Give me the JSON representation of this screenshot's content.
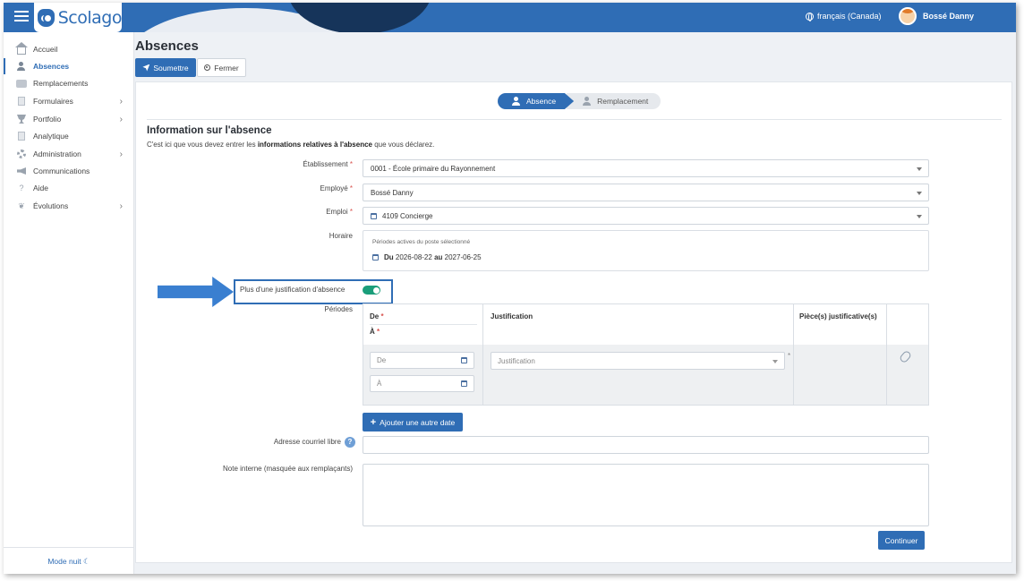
{
  "app": {
    "logo_text": "Scolago"
  },
  "header": {
    "language": "français (Canada)",
    "user_name": "Bossé Danny"
  },
  "sidebar": {
    "items": [
      {
        "label": "Accueil",
        "icon": "home-icon"
      },
      {
        "label": "Absences",
        "icon": "person-icon",
        "active": true
      },
      {
        "label": "Remplacements",
        "icon": "chat-icon"
      },
      {
        "label": "Formulaires",
        "icon": "document-icon",
        "has_submenu": true
      },
      {
        "label": "Portfolio",
        "icon": "trophy-icon",
        "has_submenu": true
      },
      {
        "label": "Analytique",
        "icon": "document-icon"
      },
      {
        "label": "Administration",
        "icon": "gear-icon",
        "has_submenu": true
      },
      {
        "label": "Communications",
        "icon": "megaphone-icon"
      },
      {
        "label": "Aide",
        "icon": "question-icon"
      },
      {
        "label": "Évolutions",
        "icon": "sprout-icon",
        "has_submenu": true
      }
    ],
    "night_mode": "Mode nuit"
  },
  "page": {
    "title": "Absences",
    "submit_label": "Soumettre",
    "close_label": "Fermer"
  },
  "steps": {
    "step1": "Absence",
    "step2": "Remplacement"
  },
  "form": {
    "section_title": "Information sur l'absence",
    "desc_before": "C'est ici que vous devez entrer les ",
    "desc_bold": "informations relatives à l'absence",
    "desc_after": " que vous déclarez.",
    "etablissement_label": "Établissement",
    "etablissement_value": "0001 - École primaire du Rayonnement",
    "employe_label": "Employé",
    "employe_value": "Bossé Danny",
    "emploi_label": "Emploi",
    "emploi_value": "4109 Concierge",
    "horaire_label": "Horaire",
    "horaire_sub": "Périodes actives du poste sélectionné",
    "horaire_du": "Du",
    "horaire_start": "2026-08-22",
    "horaire_au": "au",
    "horaire_end": "2027-06-25",
    "multi_justification_label": "Plus d'une justification d'absence",
    "multi_justification_on": true,
    "periods_label": "Périodes",
    "col_from": "De",
    "col_to": "À",
    "col_justification": "Justification",
    "col_documents": "Pièce(s) justificative(s)",
    "from_placeholder": "De",
    "to_placeholder": "À",
    "justification_placeholder": "Justification",
    "add_date_label": "Ajouter une autre date",
    "email_label": "Adresse courriel libre",
    "note_label": "Note interne (masquée aux remplaçants)",
    "continue_label": "Continuer",
    "required_mark": "*",
    "help_mark": "?"
  },
  "colors": {
    "primary": "#2f6db5",
    "toggle_on": "#1a9e7a",
    "required": "#d9534f"
  }
}
